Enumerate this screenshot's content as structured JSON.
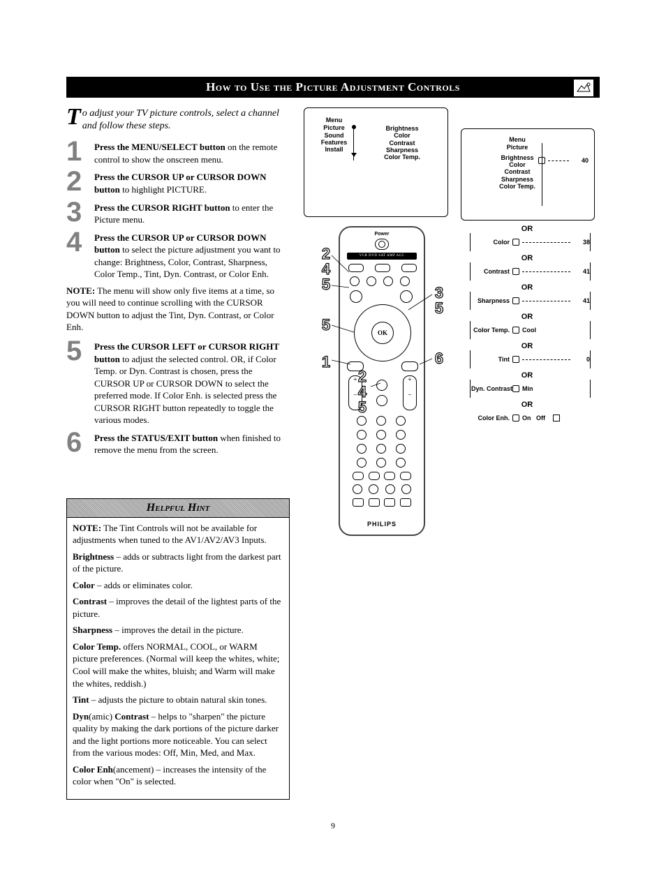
{
  "title": "How to Use the Picture Adjustment Controls",
  "intro_first": "T",
  "intro_rest": "o adjust your TV picture controls, select a channel and follow these steps.",
  "steps": [
    {
      "n": "1",
      "bold": "Press the MENU/SELECT button",
      "rest": " on the remote control to show the onscreen menu."
    },
    {
      "n": "2",
      "bold": "Press the CURSOR UP or CURSOR DOWN button",
      "rest": " to highlight PICTURE."
    },
    {
      "n": "3",
      "bold": "Press the CURSOR RIGHT button",
      "rest": " to enter the Picture menu."
    },
    {
      "n": "4",
      "bold": "Press the CURSOR UP or CURSOR DOWN button",
      "rest": " to select the  picture adjustment you want to change:  Brightness, Color, Contrast, Sharpness, Color Temp., Tint, Dyn. Contrast, or Color Enh."
    }
  ],
  "note1_bold": "NOTE:",
  "note1_text": "  The menu will show only five items at a time, so you will need to continue scrolling with the CURSOR DOWN button to adjust the Tint, Dyn. Contrast, or Color Enh.",
  "steps2": [
    {
      "n": "5",
      "bold": "Press the CURSOR LEFT or CURSOR RIGHT button",
      "rest": " to adjust the selected control. OR, if Color Temp. or Dyn. Contrast is chosen, press the CURSOR UP or CURSOR DOWN to select the preferred mode. If Color Enh. is selected press the CURSOR RIGHT button repeatedly to toggle the various modes."
    },
    {
      "n": "6",
      "bold": "Press the STATUS/EXIT button",
      "rest": " when finished to remove the menu from the screen."
    }
  ],
  "hint_title": "Helpful Hint",
  "hints": {
    "p1b": "NOTE:",
    "p1": " The Tint Controls will not be available for adjustments when tuned to the AV1/AV2/AV3 Inputs.",
    "p2b": "Brightness",
    "p2": " – adds or subtracts light from the darkest part of the picture.",
    "p3b": "Color",
    "p3": " – adds or eliminates color.",
    "p4b": "Contrast",
    "p4": " – improves the detail of the lightest parts of the picture.",
    "p5b": "Sharpness",
    "p5": " – improves the detail in the picture.",
    "p6b": "Color Temp.",
    "p6": " offers NORMAL, COOL, or WARM picture preferences. (Normal will keep the whites, white; Cool will make the whites, bluish; and Warm will make the whites, reddish.)",
    "p7b": "Tint",
    "p7": " – adjusts the picture to obtain natural skin tones.",
    "p8b": "Dyn",
    "p8mid": "(amic)",
    "p8b2": " Contrast",
    "p8": " – helps to \"sharpen\" the picture quality by making the dark portions of the picture darker and the light portions more noticeable.  You can select from the various modes: Off, Min, Med, and Max.",
    "p9b": "Color Enh",
    "p9mid": "(ancement)",
    "p9": " – increases the intensity of the color when \"On\" is selected."
  },
  "screen1": {
    "menu_title": "Menu",
    "left": [
      "Picture",
      "Sound",
      "Features",
      "Install"
    ],
    "right_title": "",
    "right": [
      "Brightness",
      "Color",
      "Contrast",
      "Sharpness",
      "Color Temp."
    ]
  },
  "screen2": {
    "menu_title": "Menu",
    "sub": "Picture",
    "items": [
      "Brightness",
      "Color",
      "Contrast",
      "Sharpness",
      "Color Temp."
    ],
    "value": "40"
  },
  "sliders": [
    {
      "label": "Color",
      "val": "38"
    },
    {
      "label": "Contrast",
      "val": "41"
    },
    {
      "label": "Sharpness",
      "val": "41"
    },
    {
      "label": "Color Temp.",
      "val": "Cool"
    },
    {
      "label": "Tint",
      "val": "0"
    },
    {
      "label": "Dyn. Contrast",
      "val": "Min"
    },
    {
      "label": "Color Enh.",
      "val": "On",
      "extra": "Off"
    }
  ],
  "or_label": "OR",
  "remote": {
    "brand": "PHILIPS",
    "ok": "OK",
    "power": "Power",
    "bar": "VCR DVD SAT AMP ACC"
  },
  "callouts_left": [
    "2",
    "4",
    "5",
    "5",
    "1"
  ],
  "callouts_right": [
    "3",
    "5",
    "6"
  ],
  "callouts_bottom": [
    "2",
    "4",
    "5"
  ],
  "page_number": "9"
}
